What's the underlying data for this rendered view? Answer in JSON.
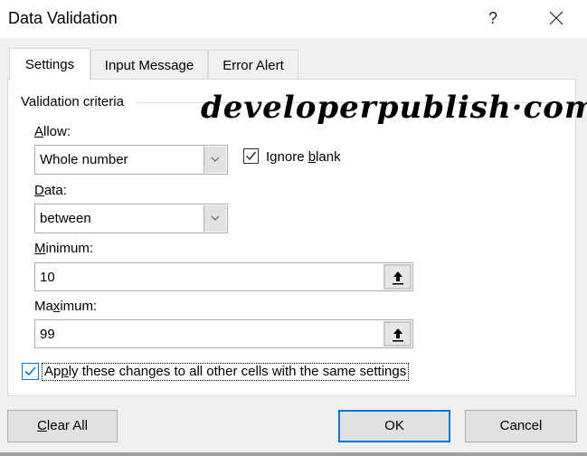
{
  "window": {
    "title": "Data Validation",
    "help_label": "?",
    "close_icon": "close-icon"
  },
  "tabs": [
    {
      "label": "Settings",
      "active": true
    },
    {
      "label": "Input Message",
      "active": false
    },
    {
      "label": "Error Alert",
      "active": false
    }
  ],
  "settings": {
    "group_label": "Validation criteria",
    "watermark": "developerpublish·com",
    "allow": {
      "label_accel": "A",
      "label_rest": "llow:",
      "value": "Whole number"
    },
    "ignore_blank": {
      "label_pre": "Ignore ",
      "label_accel": "b",
      "label_post": "lank",
      "checked": true
    },
    "data": {
      "label_accel": "D",
      "label_rest": "ata:",
      "value": "between"
    },
    "minimum": {
      "label_accel": "M",
      "label_rest": "inimum:",
      "value": "10"
    },
    "maximum": {
      "label_pre": "Ma",
      "label_accel": "x",
      "label_post": "imum:",
      "value": "99"
    },
    "apply_all": {
      "label_pre": "Ap",
      "label_accel": "p",
      "label_post": "ly these changes to all other cells with the same settings",
      "checked": true
    }
  },
  "buttons": {
    "clear_all_accel": "C",
    "clear_all_rest": "lear All",
    "ok": "OK",
    "cancel": "Cancel"
  },
  "colors": {
    "accent": "#0078d7",
    "panel_bg": "#ffffff",
    "dialog_bg": "#f0f0f0"
  }
}
